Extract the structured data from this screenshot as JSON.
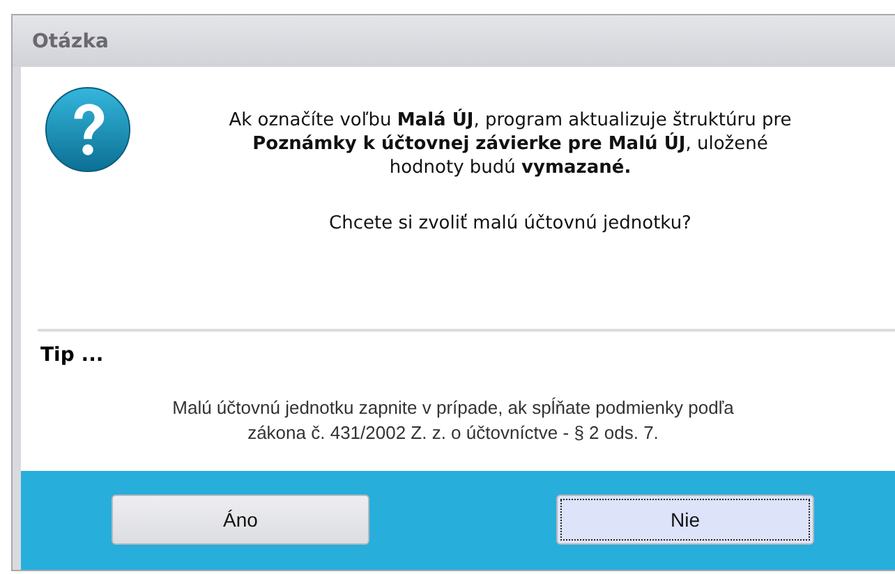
{
  "window": {
    "title": "Otázka"
  },
  "message": {
    "text": "Ak označíte voľbu **Malá ÚJ**, program aktualizuje štruktúru pre\n**Poznámky k účtovnej závierke pre Malú ÚJ**, uložené\nhodnoty budú **vymazané.**",
    "question": "Chcete si zvoliť malú účtovnú jednotku?"
  },
  "tip": {
    "title": "Tip ...",
    "text": "Malú účtovnú jednotku zapnite v prípade, ak spĺňate podmienky podľa\nzákona č. 431/2002 Z. z. o účtovníctve - § 2 ods. 7."
  },
  "buttons": [
    {
      "label": "Áno",
      "focused": false
    },
    {
      "label": "Nie",
      "focused": true
    }
  ]
}
